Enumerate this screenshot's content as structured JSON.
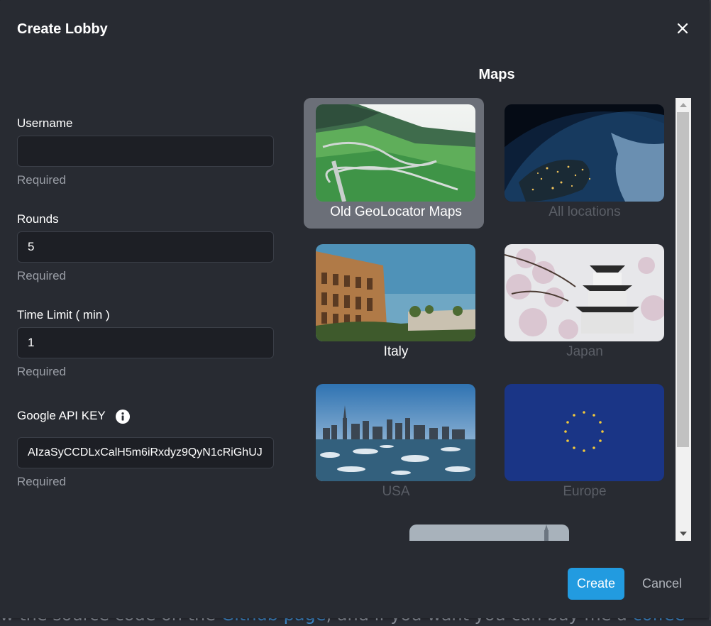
{
  "background": {
    "text_before": "w the source code on the ",
    "link1": "Github page",
    "text_middle": ", and if you want you can buy me a ",
    "link2": "coffee"
  },
  "dialog": {
    "title": "Create Lobby",
    "close_icon": "close-icon"
  },
  "form": {
    "username": {
      "label": "Username",
      "value": "",
      "helper": "Required"
    },
    "rounds": {
      "label": "Rounds",
      "value": "5",
      "helper": "Required"
    },
    "time_limit": {
      "label": "Time Limit ( min )",
      "value": "1",
      "helper": "Required"
    },
    "api_key": {
      "label": "Google API KEY",
      "value": "AIzaSyCCDLxCalH5m6iRxdyz9QyN1cRiGhUJ",
      "helper": "Required",
      "icon": "info-icon"
    }
  },
  "maps": {
    "title": "Maps",
    "items": [
      {
        "label": "Old GeoLocator Maps",
        "selected": true,
        "image": "mountain-road"
      },
      {
        "label": "All locations",
        "selected": false,
        "image": "earth-night"
      },
      {
        "label": "Italy",
        "selected": false,
        "image": "colosseum"
      },
      {
        "label": "Japan",
        "selected": false,
        "image": "japanese-castle-blossoms"
      },
      {
        "label": "USA",
        "selected": false,
        "image": "new-york-skyline"
      },
      {
        "label": "Europe",
        "selected": false,
        "image": "eu-flag"
      },
      {
        "label": "",
        "selected": false,
        "image": "city-partial"
      }
    ]
  },
  "actions": {
    "create_label": "Create",
    "cancel_label": "Cancel"
  },
  "colors": {
    "dialog_bg": "#282b32",
    "input_bg": "#1d1f25",
    "accent": "#229be0",
    "selected_card": "#6b6f78"
  }
}
